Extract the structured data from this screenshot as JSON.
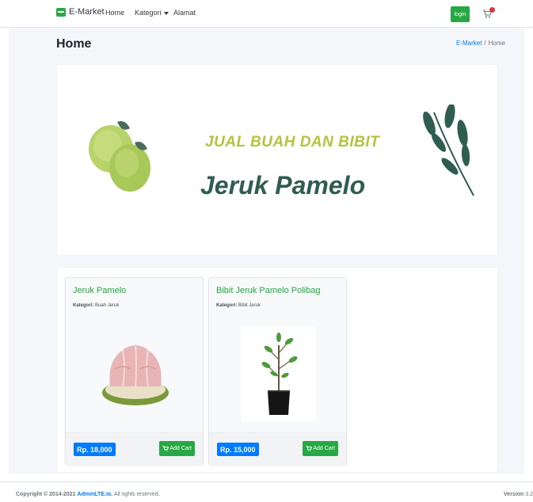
{
  "navbar": {
    "brand": "E-Market",
    "links": [
      "Home",
      "Kategori",
      "Alamat"
    ],
    "login_label": "login",
    "colors": {
      "accent": "#28a745",
      "badge": "#dc3545"
    }
  },
  "page": {
    "title": "Home",
    "breadcrumb": [
      "E-Market",
      "Home"
    ]
  },
  "banner": {
    "subtitle": "JUAL BUAH DAN BIBIT",
    "title": "Jeruk Pamelo",
    "colors": {
      "subtitle": "#b3c43c",
      "title": "#2f5d50"
    }
  },
  "products": [
    {
      "name": "Jeruk Pamelo",
      "category_label": "Kategori:",
      "category": "Buah Jeruk",
      "price": "Rp. 18,000",
      "add_cart_label": "Add Cart",
      "image_icon": "pomelo-fruit-image"
    },
    {
      "name": "Bibit Jeruk Pamelo Polibag",
      "category_label": "Kategori:",
      "category": "Bibit Jeruk",
      "price": "Rp. 15,000",
      "add_cart_label": "Add Cart",
      "image_icon": "seedling-polybag-image"
    }
  ],
  "footer": {
    "copyright_prefix": "Copyright © 2014-2021",
    "copyright_link": "AdminLTE.io.",
    "copyright_suffix": "All rights reserved.",
    "version_label": "Version",
    "version_number": "3.2"
  }
}
